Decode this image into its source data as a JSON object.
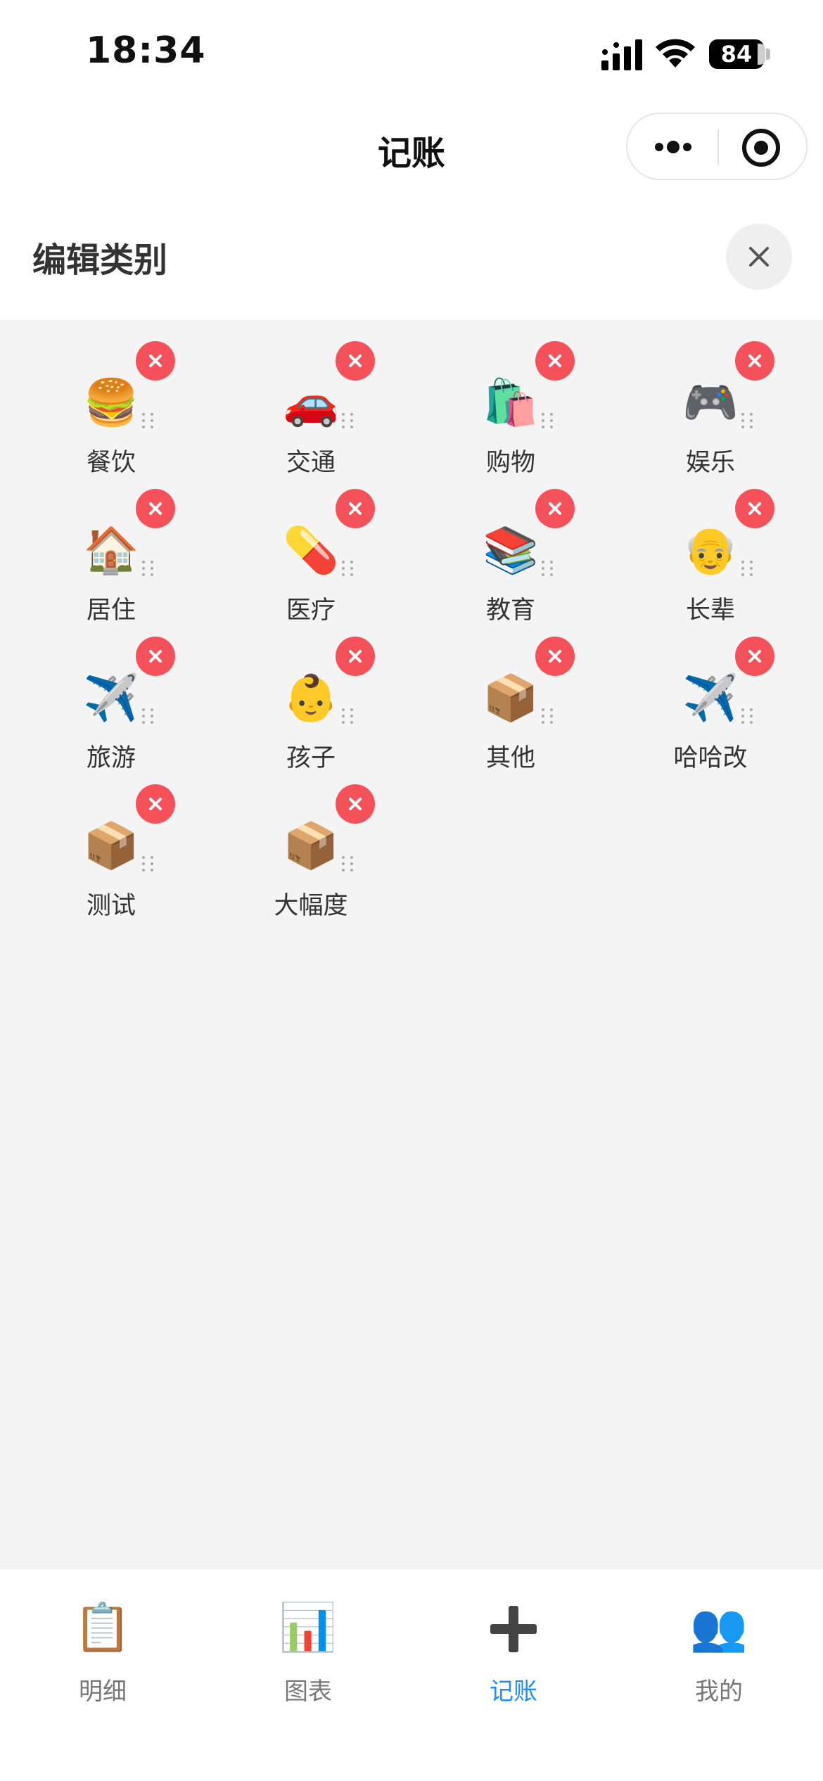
{
  "status_bar": {
    "time": "18:34",
    "battery": "84",
    "battery_level": 0.84
  },
  "nav": {
    "title": "记账"
  },
  "panel": {
    "title": "编辑类别"
  },
  "categories": [
    {
      "icon": "🍔",
      "label": "餐饮"
    },
    {
      "icon": "🚗",
      "label": "交通"
    },
    {
      "icon": "🛍️",
      "label": "购物"
    },
    {
      "icon": "🎮",
      "label": "娱乐"
    },
    {
      "icon": "🏠",
      "label": "居住"
    },
    {
      "icon": "💊",
      "label": "医疗"
    },
    {
      "icon": "📚",
      "label": "教育"
    },
    {
      "icon": "👴",
      "label": "长辈"
    },
    {
      "icon": "✈️",
      "label": "旅游"
    },
    {
      "icon": "👶",
      "label": "孩子"
    },
    {
      "icon": "📦",
      "label": "其他"
    },
    {
      "icon": "✈️",
      "label": "哈哈改"
    },
    {
      "icon": "📦",
      "label": "测试"
    },
    {
      "icon": "📦",
      "label": "大幅度"
    }
  ],
  "tabs": [
    {
      "icon": "📋",
      "label": "明细",
      "active": false
    },
    {
      "icon": "📊",
      "label": "图表",
      "active": false
    },
    {
      "icon": "plus-icon",
      "label": "记账",
      "active": true
    },
    {
      "icon": "👥",
      "label": "我的",
      "active": false
    }
  ],
  "colors": {
    "accent": "#1a8cff",
    "delete": "#f5515b",
    "grid_background": "#f4f4f4"
  }
}
